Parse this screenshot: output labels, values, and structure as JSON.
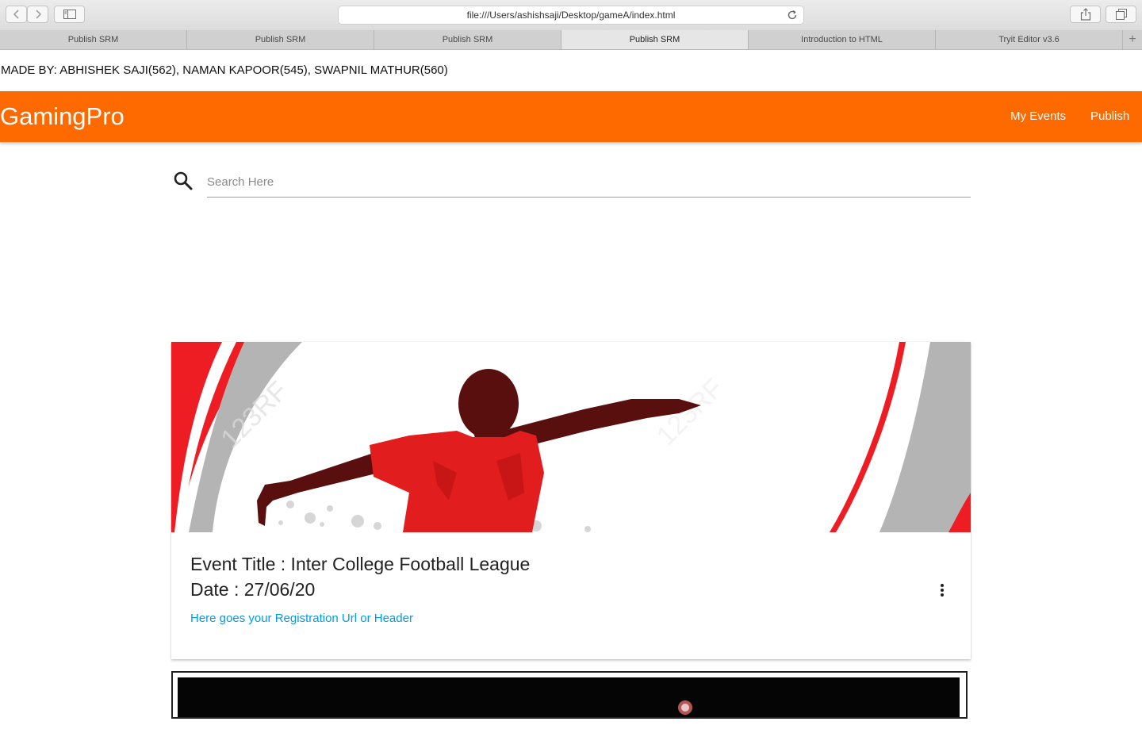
{
  "browser": {
    "url": "file:///Users/ashishsaji/Desktop/gameA/index.html",
    "tabs": [
      {
        "label": "Publish SRM",
        "active": false
      },
      {
        "label": "Publish SRM",
        "active": false
      },
      {
        "label": "Publish SRM",
        "active": false
      },
      {
        "label": "Publish SRM",
        "active": true
      },
      {
        "label": "Introduction to HTML",
        "active": false
      },
      {
        "label": "Tryit Editor v3.6",
        "active": false
      }
    ],
    "icons": [
      "back-icon",
      "forward-icon",
      "sidebar-icon",
      "reload-icon",
      "share-icon",
      "tabs-overview-icon",
      "new-tab-icon"
    ]
  },
  "page": {
    "credit": "MADE BY: ABHISHEK SAJI(562), NAMAN KAPOOR(545), SWAPNIL MATHUR(560)",
    "nav": {
      "brand": "GamingPro",
      "links": [
        "My Events",
        "Publish"
      ],
      "color": "#ff6a00"
    },
    "search": {
      "placeholder": "Search Here",
      "value": ""
    },
    "event_card": {
      "title": "Event Title : Inter College Football League",
      "date": "Date : 27/06/20",
      "link": "Here goes your Registration Url or Header",
      "link_color": "#039be5"
    }
  }
}
